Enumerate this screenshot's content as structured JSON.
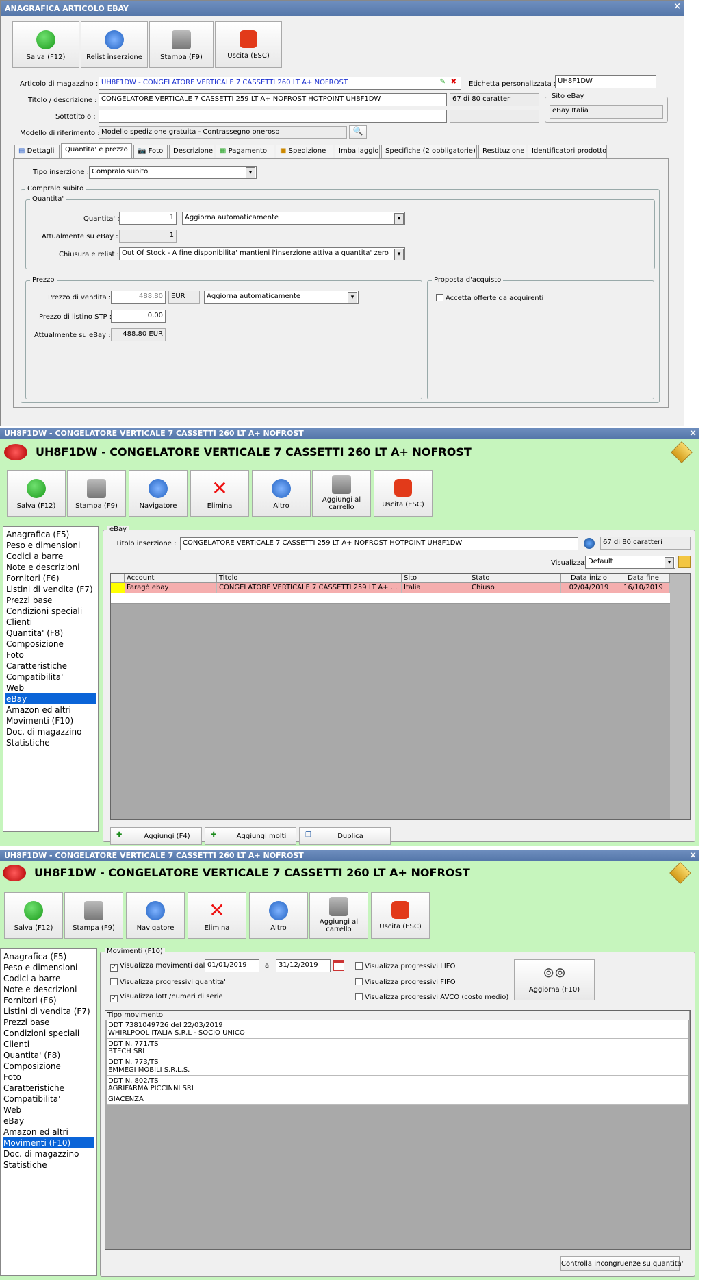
{
  "w1": {
    "title": "ANAGRAFICA ARTICOLO EBAY",
    "close": "×",
    "toolbar": {
      "save": "Salva (F12)",
      "relist": "Relist inserzione",
      "print": "Stampa (F9)",
      "exit": "Uscita (ESC)"
    },
    "fields": {
      "articolo_label": "Articolo di magazzino :",
      "articolo_value": "UH8F1DW - CONGELATORE VERTICALE 7 CASSETTI 260 LT A+ NOFROST",
      "etichetta_label": "Etichetta personalizzata :",
      "etichetta_value": "UH8F1DW",
      "titolo_label": "Titolo / descrizione :",
      "titolo_value": "CONGELATORE VERTICALE 7 CASSETTI 259 LT A+ NOFROST HOTPOINT UH8F1DW",
      "char_count": "67 di 80 caratteri",
      "sottotitolo_label": "Sottotitolo :",
      "sottotitolo_value": "",
      "modello_label": "Modello di riferimento :",
      "modello_value": "Modello spedizione gratuita - Contrassegno oneroso",
      "sito_title": "Sito eBay",
      "sito_value": "eBay Italia"
    },
    "tabs": [
      "Dettagli",
      "Quantita' e prezzo",
      "Foto",
      "Descrizione",
      "Pagamento",
      "Spedizione",
      "Imballaggio",
      "Specifiche (2 obbligatorie)",
      "Restituzione",
      "Identificatori prodotto"
    ],
    "tipo_label": "Tipo inserzione :",
    "tipo_value": "Compralo subito",
    "compralo_title": "Compralo subito",
    "quantita_title": "Quantita'",
    "qty_label": "Quantita' :",
    "qty_value": "1",
    "qty_mode": "Aggiorna automaticamente",
    "attual_label": "Attualmente su eBay :",
    "attual_value": "1",
    "chiusura_label": "Chiusura e relist :",
    "chiusura_value": "Out Of Stock - A fine disponibilita' mantieni l'inserzione attiva a quantita' zero",
    "prezzo_title": "Prezzo",
    "prezzo_vendita_label": "Prezzo di vendita :",
    "prezzo_vendita_value": "488,80",
    "currency": "EUR",
    "prezzo_mode": "Aggiorna automaticamente",
    "listino_label": "Prezzo di listino STP :",
    "listino_value": "0,00",
    "attual_prezzo_label": "Attualmente su eBay :",
    "attual_prezzo_value": "488,80 EUR",
    "proposta_title": "Proposta d'acquisto",
    "proposta_check": "Accetta offerte da acquirenti"
  },
  "w2": {
    "title": "UH8F1DW - CONGELATORE VERTICALE 7 CASSETTI 260 LT A+ NOFROST",
    "close": "×",
    "heading": "UH8F1DW - CONGELATORE VERTICALE 7 CASSETTI 260 LT A+ NOFROST",
    "toolbar": {
      "save": "Salva (F12)",
      "print": "Stampa (F9)",
      "nav": "Navigatore",
      "del": "Elimina",
      "other": "Altro",
      "cart1": "Aggiungi al",
      "cart2": "carrello",
      "exit": "Uscita (ESC)"
    },
    "sidebar": [
      "Anagrafica (F5)",
      "Peso e dimensioni",
      "Codici a barre",
      "Note e descrizioni",
      "Fornitori (F6)",
      "Listini di vendita (F7)",
      "Prezzi base",
      "Condizioni speciali",
      "Clienti",
      "Quantita' (F8)",
      "Composizione",
      "Foto",
      "Caratteristiche",
      "Compatibilita'",
      "Web",
      "eBay",
      "Amazon ed altri",
      "Movimenti (F10)",
      "Doc. di magazzino",
      "Statistiche"
    ],
    "group": "eBay",
    "titolo_label": "Titolo inserzione :",
    "titolo_value": "CONGELATORE VERTICALE 7 CASSETTI 259 LT A+ NOFROST HOTPOINT UH8F1DW",
    "char_count": "67 di 80 caratteri",
    "vis_label": "Visualizzazione :",
    "vis_value": "Default",
    "columns": [
      "Account",
      "Titolo",
      "Sito",
      "Stato",
      "Data inizio",
      "Data fine"
    ],
    "row": [
      "Faragò ebay",
      "CONGELATORE VERTICALE 7 CASSETTI 259 LT A+ ...",
      "Italia",
      "Chiuso",
      "02/04/2019",
      "16/10/2019"
    ],
    "buttons": {
      "add": "Aggiungi (F4)",
      "add_many": "Aggiungi molti",
      "dup": "Duplica"
    }
  },
  "w3": {
    "title": "UH8F1DW - CONGELATORE VERTICALE 7 CASSETTI 260 LT A+ NOFROST",
    "close": "×",
    "heading": "UH8F1DW - CONGELATORE VERTICALE 7 CASSETTI 260 LT A+ NOFROST",
    "group": "Movimenti (F10)",
    "vis_dal": "Visualizza movimenti dal",
    "date_from": "01/01/2019",
    "al": "al",
    "date_to": "31/12/2019",
    "vis_qty": "Visualizza progressivi quantita'",
    "vis_lotti": "Visualizza lotti/numeri di serie",
    "lifo": "Visualizza progressivi LIFO",
    "fifo": "Visualizza progressivi FIFO",
    "avco": "Visualizza progressivi AVCO (costo medio)",
    "refresh": "Aggiorna (F10)",
    "col": "Tipo movimento",
    "movs": [
      {
        "l1": "DDT 7381049726 del 22/03/2019",
        "l2": "WHIRLPOOL ITALIA S.R.L - SOCIO UNICO"
      },
      {
        "l1": "DDT N. 771/TS",
        "l2": "BTECH SRL"
      },
      {
        "l1": "DDT N. 773/TS",
        "l2": "EMMEGI MOBILI S.R.L.S."
      },
      {
        "l1": "DDT N. 802/TS",
        "l2": "AGRIFARMA PICCINNI SRL"
      }
    ],
    "giacenza": "GIACENZA",
    "check_btn": "Controlla incongruenze su quantita'"
  },
  "colors": {
    "title_blue": "#5b7db1",
    "green_bg": "#c8f5c0",
    "selected": "#0a64d8",
    "row_pink": "#f4a8a8"
  }
}
